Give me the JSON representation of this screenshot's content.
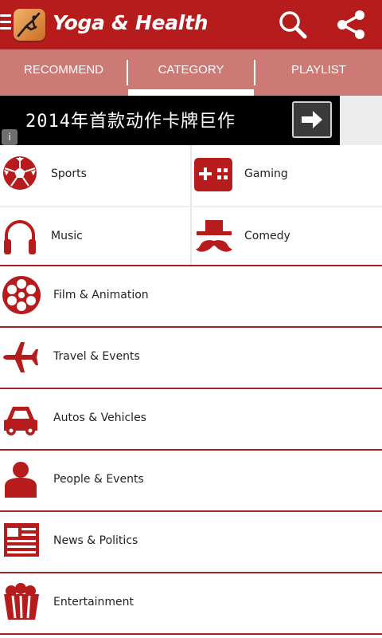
{
  "app": {
    "title": "Yoga & Health",
    "accent_color": "#b71c1c",
    "tab_bar_color": "#cd7a76",
    "icons": {
      "menu": "menu-icon",
      "logo": "yoga-pose-logo",
      "search": "search-icon",
      "share": "share-icon"
    }
  },
  "tabs": [
    {
      "label": "RECOMMEND",
      "selected": false
    },
    {
      "label": "CATEGORY",
      "selected": true
    },
    {
      "label": "PLAYLIST",
      "selected": false
    }
  ],
  "ad": {
    "text": "2014年首款动作卡牌巨作",
    "info_glyph": "i",
    "arrow_icon": "arrow-right-icon"
  },
  "categories": {
    "grid": [
      {
        "label": "Sports",
        "icon": "soccer-ball-icon"
      },
      {
        "label": "Gaming",
        "icon": "gamepad-icon"
      },
      {
        "label": "Music",
        "icon": "headphones-icon"
      },
      {
        "label": "Comedy",
        "icon": "hat-mustache-icon"
      }
    ],
    "list": [
      {
        "label": "Film & Animation",
        "icon": "film-reel-icon"
      },
      {
        "label": "Travel & Events",
        "icon": "airplane-icon"
      },
      {
        "label": "Autos & Vehicles",
        "icon": "car-icon"
      },
      {
        "label": "People & Events",
        "icon": "person-icon"
      },
      {
        "label": "News & Politics",
        "icon": "newspaper-icon"
      },
      {
        "label": "Entertainment",
        "icon": "popcorn-icon"
      }
    ]
  }
}
